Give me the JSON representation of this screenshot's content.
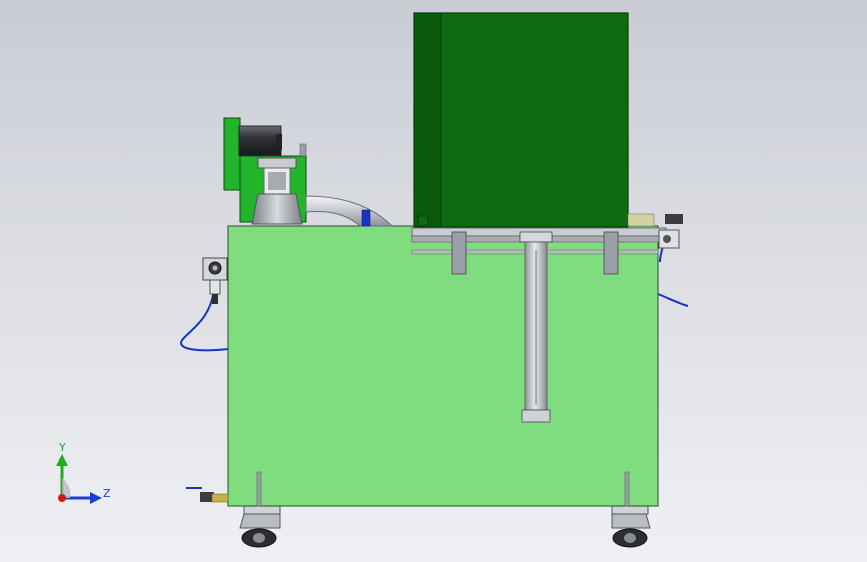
{
  "triad": {
    "y_label": "Y",
    "z_label": "Z",
    "y_color": "#22aa22",
    "z_color": "#1a3fd0",
    "origin_color": "#d01818"
  },
  "colors": {
    "cabinet": "#7fdd80",
    "enclosure": "#0d6b10",
    "enclosure_dark": "#0a5a0c",
    "bracket": "#22b52c",
    "pipe": "#c8ccd2",
    "hose": "#1633c4",
    "metal": "#9a9ea6",
    "dark_metal": "#3a3c40",
    "brass": "#c9b04a"
  }
}
